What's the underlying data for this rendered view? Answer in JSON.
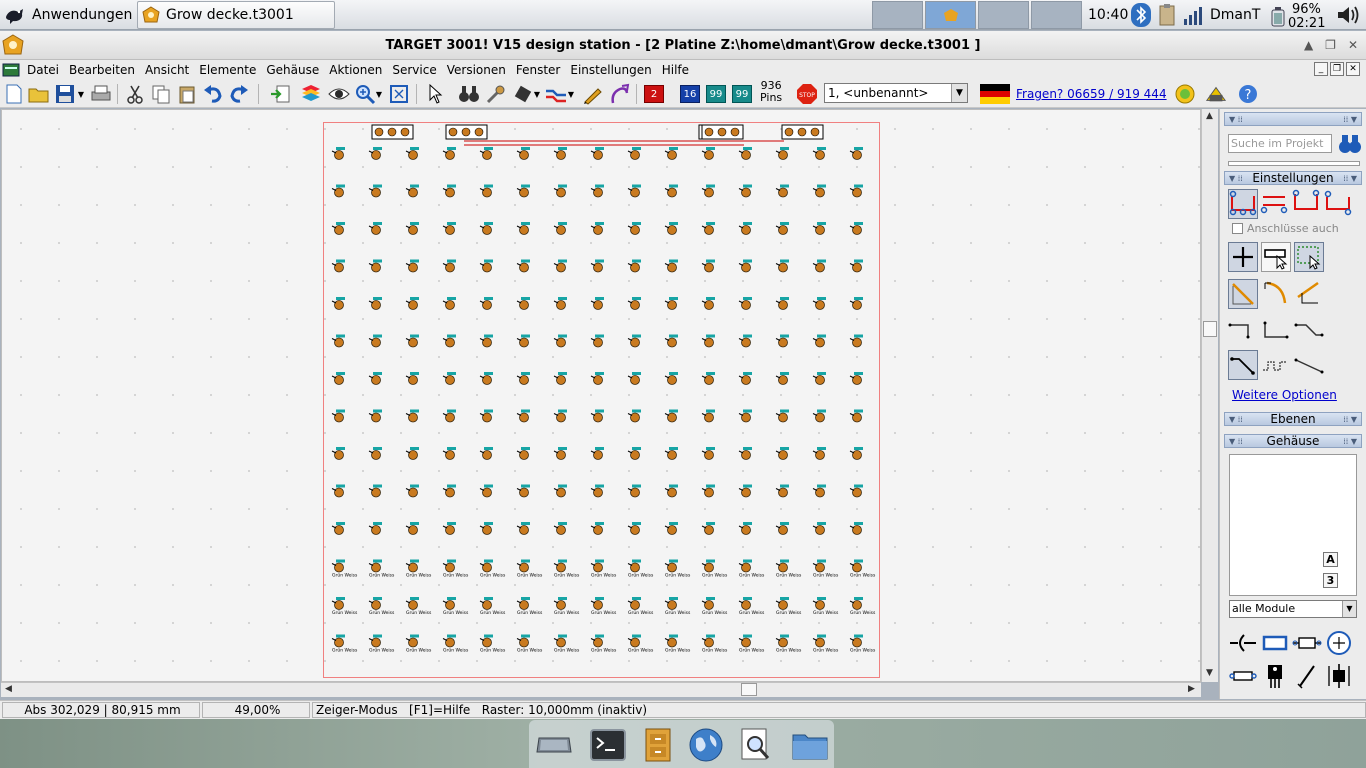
{
  "system_panel": {
    "apps_label": "Anwendungen",
    "task_title": "Grow decke.t3001",
    "clock": "10:40",
    "user": "DmanT",
    "battery_percent": "96%",
    "battery_time": "02:21"
  },
  "window": {
    "title": "TARGET 3001! V15 design station - [2 Platine Z:\\home\\dmant\\Grow decke.t3001 ]"
  },
  "menu": {
    "items": [
      "Datei",
      "Bearbeiten",
      "Ansicht",
      "Elemente",
      "Gehäuse",
      "Aktionen",
      "Service",
      "Versionen",
      "Fenster",
      "Einstellungen",
      "Hilfe"
    ]
  },
  "toolbar": {
    "pins_count": "936",
    "pins_label": "Pins",
    "sheet_select_value": "1, <unbenannt>",
    "hotline": "Fragen? 06659 / 919 444",
    "layer_badges": [
      "2",
      "16",
      "99",
      "99"
    ],
    "stop_label": "STOP"
  },
  "statusbar": {
    "coords": "Abs 302,029 | 80,915 mm",
    "zoom": "49,00%",
    "mode": "Zeiger-Modus   [F1]=Hilfe   Raster: 10,000mm (inaktiv)"
  },
  "right_panel": {
    "search_placeholder": "Suche im Projekt",
    "einstellungen_title": "Einstellungen",
    "anschluesse_label": "Anschlüsse auch",
    "weitere_optionen": "Weitere Optionen",
    "ebenen_title": "Ebenen",
    "gehaeuse_title": "Gehäuse",
    "mini_buttons": [
      "A",
      "3"
    ],
    "module_select_value": "alle Module"
  },
  "board": {
    "columns": 15,
    "rows": 14,
    "led_label": "Grün Weiss",
    "colors": {
      "outline": "#f08080",
      "pad": "#c97a1f",
      "label": "#17a5a5",
      "track": "#cc0000"
    }
  }
}
